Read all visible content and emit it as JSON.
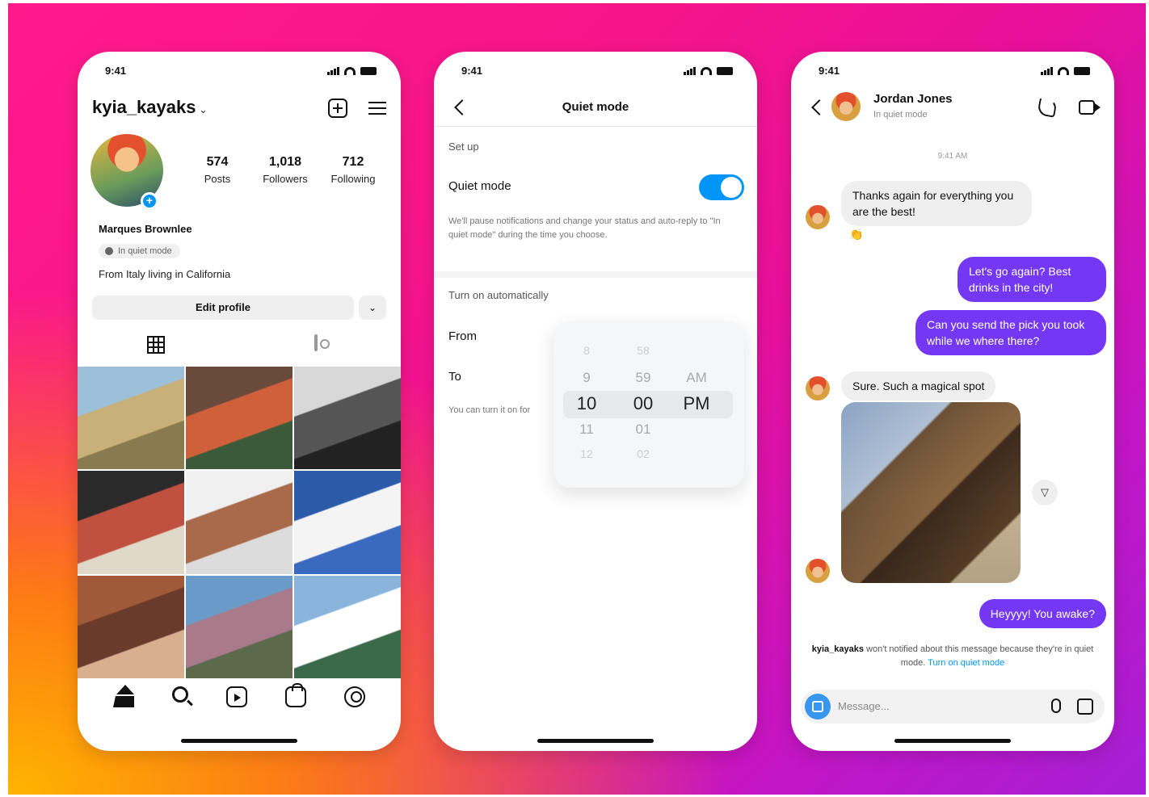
{
  "colors": {
    "accent_blue": "#0095f6",
    "bubble_purple": "#7438f5",
    "gradient_pink": "#ff1a8c",
    "gradient_purple": "#a61fd6",
    "gradient_orange": "#ffb400"
  },
  "phone1": {
    "time": "9:41",
    "username": "kyia_kayaks",
    "username_chevron": "⌄",
    "icons": [
      "add-post-icon",
      "menu-icon"
    ],
    "stats": [
      {
        "num": "574",
        "label": "Posts"
      },
      {
        "num": "1,018",
        "label": "Followers"
      },
      {
        "num": "712",
        "label": "Following"
      }
    ],
    "name": "Marques Brownlee",
    "quiet_chip": "In quiet mode",
    "bio": "From Italy living in California",
    "edit_profile": "Edit profile",
    "more_chevron": "⌄",
    "avatar_plus": "+",
    "tabs": [
      "grid-icon",
      "tagged-icon"
    ],
    "photos": [
      {
        "name": "photo-mountain-valley",
        "colors": [
          "#9cc0da",
          "#c8b078",
          "#8a7a50"
        ]
      },
      {
        "name": "photo-flower-balcony",
        "colors": [
          "#6a4a3a",
          "#d0603a",
          "#3a5a3a"
        ]
      },
      {
        "name": "photo-building-bw",
        "colors": [
          "#d8d8d8",
          "#555555",
          "#222222"
        ]
      },
      {
        "name": "photo-patterned-textile",
        "colors": [
          "#2a2a2a",
          "#c05040",
          "#e0d8c8"
        ]
      },
      {
        "name": "photo-white-house-door",
        "colors": [
          "#f0f0f0",
          "#a86a4a",
          "#dcdcdc"
        ]
      },
      {
        "name": "photo-pergola-sky",
        "colors": [
          "#2a5aa8",
          "#f4f4f4",
          "#3a6ac0"
        ]
      },
      {
        "name": "photo-city-street",
        "colors": [
          "#a05a3a",
          "#6a3a2a",
          "#d8b090"
        ]
      },
      {
        "name": "photo-coastal-flowers",
        "colors": [
          "#6a9ac8",
          "#a87a8a",
          "#5a6a4a"
        ]
      },
      {
        "name": "photo-white-cottage",
        "colors": [
          "#8ab4dc",
          "#ffffff",
          "#3a6a4a"
        ]
      }
    ],
    "nav": [
      "home-icon",
      "search-icon",
      "reels-icon",
      "shop-icon",
      "profile-icon"
    ]
  },
  "phone2": {
    "time": "9:41",
    "title": "Quiet mode",
    "setup_label": "Set up",
    "quiet_mode_label": "Quiet mode",
    "toggle_on": true,
    "description": "We'll pause notifications and change your status and auto-reply to \"In quiet mode\" during the time you choose.",
    "auto_label": "Turn on automatically",
    "from_label": "From",
    "to_label": "To",
    "note": "You can turn it on for",
    "picker": {
      "hours": [
        "8",
        "9",
        "10",
        "11",
        "12"
      ],
      "minutes": [
        "58",
        "59",
        "00",
        "01",
        "02"
      ],
      "ampm": [
        "AM",
        "PM"
      ],
      "selected": {
        "hour": "10",
        "minute": "00",
        "ampm": "PM"
      }
    }
  },
  "phone3": {
    "time": "9:41",
    "contact_name": "Jordan Jones",
    "contact_status": "In quiet mode",
    "timestamp": "9:41 AM",
    "messages": [
      {
        "dir": "in",
        "text": "Thanks again for everything you are the best!"
      },
      {
        "dir": "out",
        "text": "Let's go again? Best drinks in the city!"
      },
      {
        "dir": "out",
        "text": "Can you send the pick you took while we where there?"
      },
      {
        "dir": "in",
        "text": "Sure. Such a magical spot"
      },
      {
        "dir": "out",
        "text": "Heyyyy! You awake?"
      }
    ],
    "reaction": "👏",
    "share_glyph": "▽",
    "notice_user": "kyia_kayaks",
    "notice_text": " won't notified about this message because they're in quiet mode. ",
    "notice_link": "Turn on quiet mode",
    "message_placeholder": "Message..."
  }
}
